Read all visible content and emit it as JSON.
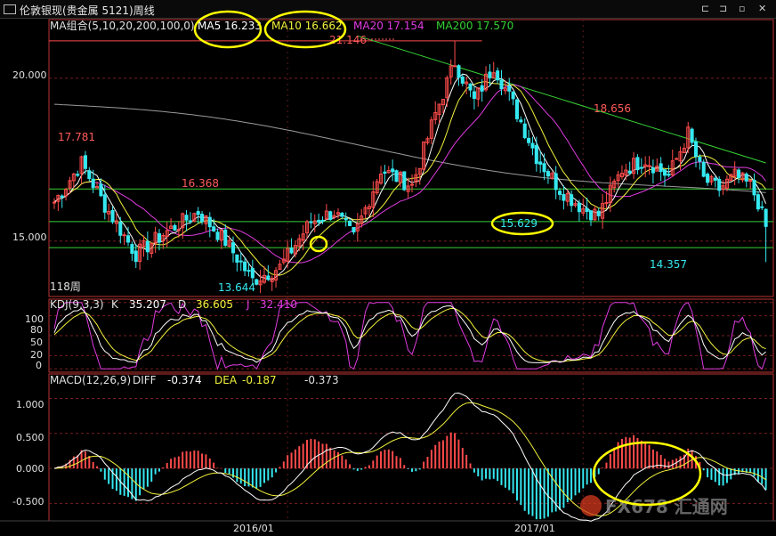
{
  "window": {
    "title": "伦敦银现(贵金属 5121)周线",
    "controls": [
      "⊏",
      "⊐",
      "▫",
      "✕"
    ]
  },
  "price_panel": {
    "ma_group_label": "MA组合(5,10,20,200,100,0)",
    "ma5_label": "MA5 16.233",
    "ma10_label": "MA10 16.662",
    "ma20_label": "MA20 17.154",
    "ma200_label": "MA200 17.570",
    "period_label": "118周",
    "y_ticks": [
      "20.000",
      "15.000"
    ],
    "annotations": {
      "high_2015": "17.781",
      "mid_2015": "16.368",
      "low_2015": "13.644",
      "peak_2016": "21.146",
      "low_2016": "15.629",
      "high_2017": "18.656",
      "last_low": "14.357"
    }
  },
  "kdj_panel": {
    "label": "KDJ(9,3,3)",
    "k_label": "K",
    "k_value": "35.207",
    "d_label": "D",
    "d_value": "36.605",
    "j_label": "J",
    "j_value": "32.410",
    "y_ticks": [
      "100",
      "80",
      "50",
      "20",
      "0"
    ]
  },
  "macd_panel": {
    "label": "MACD(12,26,9)",
    "diff_label": "DIFF",
    "diff_value": "-0.374",
    "dea_label": "DEA",
    "dea_value": "-0.187",
    "macd_value": "-0.373",
    "y_ticks": [
      "1.000",
      "0.500",
      "0.000",
      "-0.500"
    ]
  },
  "x_ticks": [
    "2016/01",
    "2017/01"
  ],
  "watermark": "FX678 汇通网",
  "colors": {
    "up": "#ff4b4b",
    "down": "#35e8f0",
    "ma5": "#ffffff",
    "ma10": "#f2f23c",
    "ma20": "#e03be0",
    "ma200": "#35d135",
    "ma100": "#9a9a9a",
    "highlight": "#ffff00"
  },
  "chart_data": {
    "type": "candlestick",
    "period": "weekly",
    "price_ylim": [
      13.3,
      21.8
    ],
    "price_waypoints": [
      {
        "week": 0,
        "close": 16.2
      },
      {
        "week": 7,
        "close": 17.4
      },
      {
        "week": 13,
        "close": 16.1
      },
      {
        "week": 21,
        "close": 14.6
      },
      {
        "week": 29,
        "close": 15.3
      },
      {
        "week": 37,
        "close": 15.9
      },
      {
        "week": 44,
        "close": 15.0
      },
      {
        "week": 51,
        "close": 13.8
      },
      {
        "week": 58,
        "close": 14.2
      },
      {
        "week": 66,
        "close": 15.6
      },
      {
        "week": 72,
        "close": 15.9
      },
      {
        "week": 77,
        "close": 15.1
      },
      {
        "week": 84,
        "close": 17.2
      },
      {
        "week": 92,
        "close": 16.7
      },
      {
        "week": 98,
        "close": 18.9
      },
      {
        "week": 103,
        "close": 20.5
      },
      {
        "week": 108,
        "close": 19.3
      },
      {
        "week": 113,
        "close": 20.4
      },
      {
        "week": 118,
        "close": 19.2
      },
      {
        "week": 124,
        "close": 17.6
      },
      {
        "week": 130,
        "close": 16.6
      },
      {
        "week": 136,
        "close": 16.0
      },
      {
        "week": 140,
        "close": 15.8
      },
      {
        "week": 146,
        "close": 17.2
      },
      {
        "week": 152,
        "close": 17.5
      },
      {
        "week": 158,
        "close": 17.0
      },
      {
        "week": 163,
        "close": 18.3
      },
      {
        "week": 167,
        "close": 16.9
      },
      {
        "week": 171,
        "close": 16.6
      },
      {
        "week": 175,
        "close": 17.0
      },
      {
        "week": 179,
        "close": 16.7
      },
      {
        "week": 181,
        "close": 16.2
      },
      {
        "week": 183,
        "close": 15.4
      }
    ],
    "horizontal_levels": [
      {
        "value": 16.6,
        "color": "#35d135"
      },
      {
        "value": 15.6,
        "color": "#35d135"
      },
      {
        "value": 14.8,
        "color": "#35d135"
      },
      {
        "value": 21.146,
        "color": "#ff4b4b"
      }
    ],
    "kdj_ylim": [
      -5,
      105
    ],
    "macd_ylim": [
      -0.75,
      1.35
    ],
    "x_ticks": [
      {
        "label": "2016/01",
        "week": 60
      },
      {
        "label": "2017/01",
        "week": 136
      }
    ]
  }
}
